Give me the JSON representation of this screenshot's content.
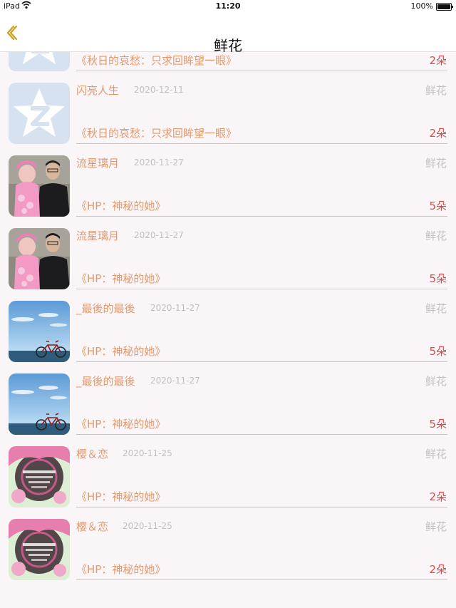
{
  "status_bar": {
    "device": "iPad",
    "time": "11:20",
    "battery": "100%",
    "battery_level": 1.0
  },
  "nav": {
    "back_icon": "chevron-left-icon",
    "title": "鲜花"
  },
  "colors": {
    "name": "#e1996f",
    "count": "#e04848",
    "muted": "#c4c1c1",
    "back": "#c9a020"
  },
  "records": [
    {
      "name": "",
      "date": "",
      "type": "",
      "book": "《秋日的哀愁：只求回眸望一眼》",
      "count": "2朵",
      "avatar": "qq-star-icon"
    },
    {
      "name": "闪亮人生",
      "date": "2020-12-11",
      "type": "鲜花",
      "book": "《秋日的哀愁：只求回眸望一眼》",
      "count": "2朵",
      "avatar": "qq-star-icon"
    },
    {
      "name": "流星璃月",
      "date": "2020-11-27",
      "type": "鲜花",
      "book": "《HP：神秘的她》",
      "count": "5朵",
      "avatar": "family-photo-icon"
    },
    {
      "name": "流星璃月",
      "date": "2020-11-27",
      "type": "鲜花",
      "book": "《HP：神秘的她》",
      "count": "5朵",
      "avatar": "family-photo-icon"
    },
    {
      "name": "_最後的最後",
      "date": "2020-11-27",
      "type": "鲜花",
      "book": "《HP：神秘的她》",
      "count": "5朵",
      "avatar": "bicycle-sky-icon"
    },
    {
      "name": "_最後的最後",
      "date": "2020-11-27",
      "type": "鲜花",
      "book": "《HP：神秘的她》",
      "count": "5朵",
      "avatar": "bicycle-sky-icon"
    },
    {
      "name": "樱＆恋",
      "date": "2020-11-25",
      "type": "鲜花",
      "book": "《HP：神秘的她》",
      "count": "2朵",
      "avatar": "pink-bicycle-icon"
    },
    {
      "name": "樱＆恋",
      "date": "2020-11-25",
      "type": "鲜花",
      "book": "《HP：神秘的她》",
      "count": "2朵",
      "avatar": "pink-bicycle-icon"
    }
  ]
}
